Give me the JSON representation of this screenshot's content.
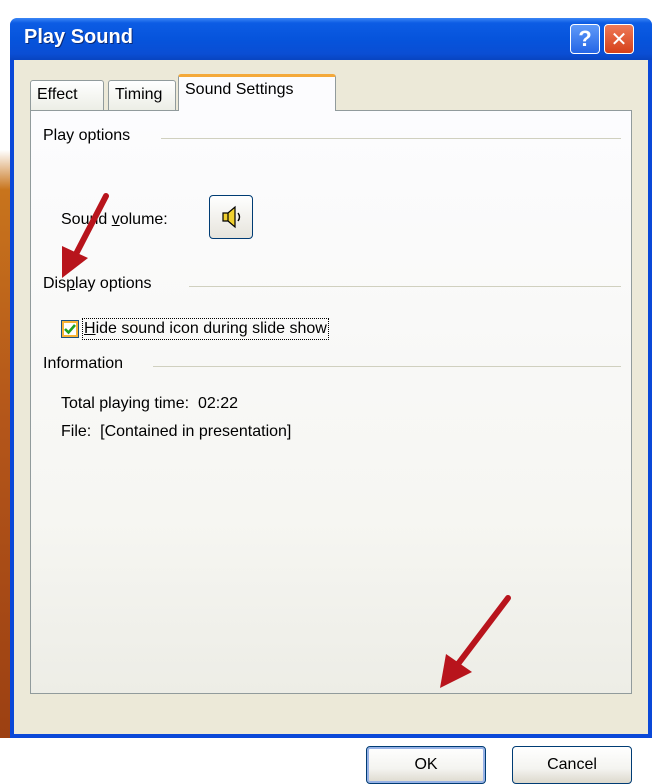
{
  "window": {
    "title": "Play Sound",
    "help_glyph": "?",
    "close_glyph": "✕"
  },
  "tabs": [
    {
      "label": "Effect",
      "active": false
    },
    {
      "label": "Timing",
      "active": false
    },
    {
      "label": "Sound Settings",
      "active": true
    }
  ],
  "play_options": {
    "heading": "Play options",
    "volume_label_pre": "Sound ",
    "volume_label_hot": "v",
    "volume_label_post": "olume:",
    "volume_icon": "speaker-icon"
  },
  "display_options": {
    "heading_pre": "Dis",
    "heading_hot": "p",
    "heading_post": "lay options",
    "checkbox_checked": true,
    "checkbox_label_hot": "H",
    "checkbox_label_rest": "ide sound icon during slide show"
  },
  "information": {
    "heading": "Information",
    "total_playing_time": "Total playing time:  02:22",
    "file": "File:  [Contained in presentation]"
  },
  "buttons": {
    "ok": "OK",
    "cancel": "Cancel"
  },
  "colors": {
    "titlebar": "#0654dc",
    "accent_tab": "#f4a93a",
    "arrow": "#b8141c",
    "checkmark": "#21a121"
  }
}
